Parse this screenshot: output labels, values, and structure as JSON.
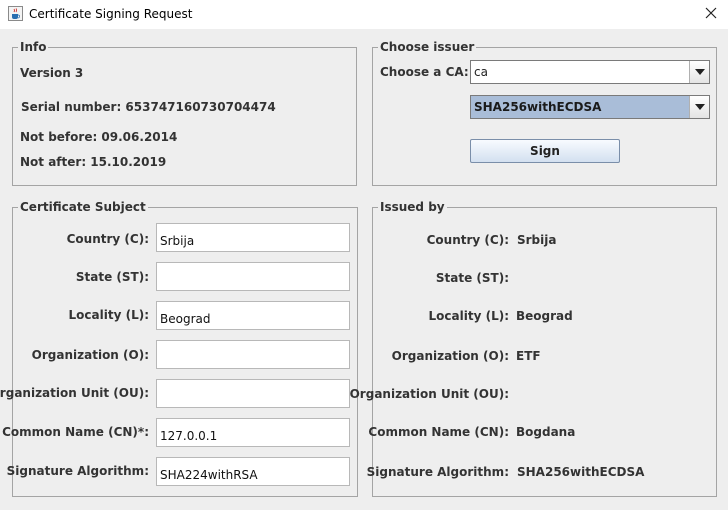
{
  "window": {
    "title": "Certificate Signing Request",
    "icon": "java-cup-icon",
    "close_icon": "close-icon"
  },
  "info": {
    "legend": "Info",
    "version": "Version 3",
    "serial": "Serial number: 653747160730704474",
    "not_before": "Not before: 09.06.2014",
    "not_after": "Not after: 15.10.2019"
  },
  "issuer": {
    "legend": "Choose issuer",
    "ca_label": "Choose a CA:",
    "ca_value": "ca",
    "algorithm_value": "SHA256withECDSA",
    "sign_label": "Sign"
  },
  "subject": {
    "legend": "Certificate Subject",
    "rows": [
      {
        "label": "Country (C):",
        "value": "Srbija"
      },
      {
        "label": "State (ST):",
        "value": ""
      },
      {
        "label": "Locality (L):",
        "value": "Beograd"
      },
      {
        "label": "Organization (O):",
        "value": ""
      },
      {
        "label": "Organization Unit (OU):",
        "value": ""
      },
      {
        "label": "Common Name (CN)*:",
        "value": "127.0.0.1"
      },
      {
        "label": "Signature Algorithm:",
        "value": "SHA224withRSA"
      }
    ]
  },
  "issued_by": {
    "legend": "Issued by",
    "rows": [
      {
        "label": "Country (C):",
        "value": "Srbija"
      },
      {
        "label": "State (ST):",
        "value": ""
      },
      {
        "label": "Locality (L):",
        "value": "Beograd"
      },
      {
        "label": "Organization (O):",
        "value": "ETF"
      },
      {
        "label": "Organization Unit (OU):",
        "value": ""
      },
      {
        "label": "Common Name (CN):",
        "value": "Bogdana"
      },
      {
        "label": "Signature Algorithm:",
        "value": "SHA256withECDSA"
      }
    ]
  }
}
